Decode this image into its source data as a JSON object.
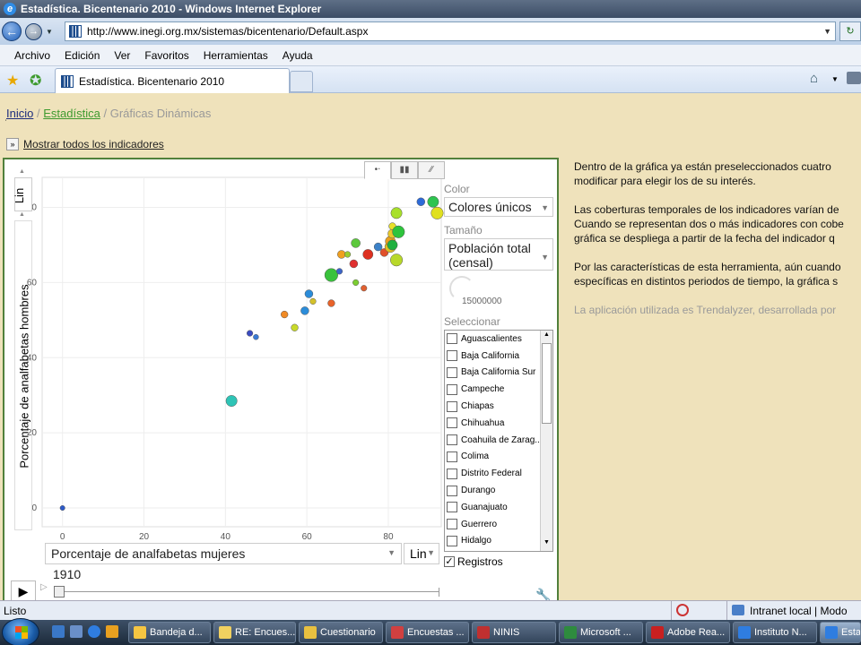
{
  "window": {
    "title": "Estadística. Bicentenario 2010 - Windows Internet Explorer"
  },
  "address": {
    "url": "http://www.inegi.org.mx/sistemas/bicentenario/Default.aspx"
  },
  "menu": [
    "Archivo",
    "Edición",
    "Ver",
    "Favoritos",
    "Herramientas",
    "Ayuda"
  ],
  "tab": {
    "title": "Estadística. Bicentenario 2010"
  },
  "breadcrumb": {
    "home": "Inicio",
    "section": "Estadística",
    "current": "Gráficas Dinámicas",
    "sep": "/"
  },
  "show_all": "Mostrar todos los indicadores",
  "chart_controls": {
    "y_scale": "Lin",
    "y_label": "Porcentaje de analfabetas hombres",
    "x_label": "Porcentaje de analfabetas mujeres",
    "x_scale": "Lin",
    "color_head": "Color",
    "color_value": "Colores únicos",
    "size_head": "Tamaño",
    "size_value": "Población total (censal)",
    "size_legend": "15000000",
    "select_head": "Seleccionar",
    "registros": "Registros",
    "year": "1910",
    "states": [
      "Aguascalientes",
      "Baja California",
      "Baja California Sur",
      "Campeche",
      "Chiapas",
      "Chihuahua",
      "Coahuila de Zarag...",
      "Colima",
      "Distrito Federal",
      "Durango",
      "Guanajuato",
      "Guerrero",
      "Hidalgo"
    ]
  },
  "chart_data": {
    "type": "scatter",
    "xlabel": "Porcentaje de analfabetas mujeres",
    "ylabel": "Porcentaje de analfabetas hombres",
    "xlim": [
      -5,
      93
    ],
    "ylim": [
      -5,
      88
    ],
    "xticks": [
      "0",
      "20",
      "40",
      "60",
      "80"
    ],
    "yticks": [
      "0",
      "20",
      "40",
      "60",
      "80"
    ],
    "points": [
      {
        "x": 0,
        "y": 0,
        "s": 1,
        "c": "#2d5ac8"
      },
      {
        "x": 41.5,
        "y": 28.5,
        "s": 4,
        "c": "#2ec4b6"
      },
      {
        "x": 46,
        "y": 46.5,
        "s": 1.5,
        "c": "#3b4cc0"
      },
      {
        "x": 47.5,
        "y": 45.5,
        "s": 1.2,
        "c": "#3a7bd5"
      },
      {
        "x": 54.5,
        "y": 51.5,
        "s": 2,
        "c": "#f08a24"
      },
      {
        "x": 57,
        "y": 48,
        "s": 2,
        "c": "#c8d92a"
      },
      {
        "x": 59.5,
        "y": 52.5,
        "s": 2.5,
        "c": "#2b8cd9"
      },
      {
        "x": 60.5,
        "y": 57,
        "s": 2.5,
        "c": "#2b8cd9"
      },
      {
        "x": 61.5,
        "y": 55,
        "s": 1.5,
        "c": "#d4c12a"
      },
      {
        "x": 66,
        "y": 54.5,
        "s": 2,
        "c": "#e8632a"
      },
      {
        "x": 66,
        "y": 62,
        "s": 5,
        "c": "#39c23c"
      },
      {
        "x": 68,
        "y": 63,
        "s": 1.5,
        "c": "#3c64c8"
      },
      {
        "x": 68.5,
        "y": 67.5,
        "s": 2.5,
        "c": "#f0a020"
      },
      {
        "x": 70,
        "y": 67.5,
        "s": 1.5,
        "c": "#9acd32"
      },
      {
        "x": 71.5,
        "y": 65,
        "s": 2.5,
        "c": "#e03030"
      },
      {
        "x": 72,
        "y": 60,
        "s": 1.5,
        "c": "#7ccd32"
      },
      {
        "x": 74,
        "y": 58.5,
        "s": 1.5,
        "c": "#e06030"
      },
      {
        "x": 72,
        "y": 70.5,
        "s": 3,
        "c": "#5cc83c"
      },
      {
        "x": 75,
        "y": 67.5,
        "s": 3.5,
        "c": "#dd3020"
      },
      {
        "x": 77.5,
        "y": 69.5,
        "s": 2.5,
        "c": "#3c82c8"
      },
      {
        "x": 79,
        "y": 68,
        "s": 2.5,
        "c": "#e0502a"
      },
      {
        "x": 80.5,
        "y": 69.5,
        "s": 4,
        "c": "#e0c020"
      },
      {
        "x": 80.5,
        "y": 71,
        "s": 3.5,
        "c": "#e8a020"
      },
      {
        "x": 81,
        "y": 73,
        "s": 3,
        "c": "#e8c82a"
      },
      {
        "x": 81,
        "y": 75,
        "s": 2,
        "c": "#e8e02a"
      },
      {
        "x": 81,
        "y": 70,
        "s": 3.5,
        "c": "#20b040"
      },
      {
        "x": 82.5,
        "y": 73.5,
        "s": 4.5,
        "c": "#2ec43c"
      },
      {
        "x": 82,
        "y": 66,
        "s": 4.5,
        "c": "#b8d82a"
      },
      {
        "x": 82,
        "y": 78.5,
        "s": 4,
        "c": "#a8e02a"
      },
      {
        "x": 88,
        "y": 81.5,
        "s": 2.5,
        "c": "#2d6ad8"
      },
      {
        "x": 91,
        "y": 81.5,
        "s": 4,
        "c": "#2ec450"
      },
      {
        "x": 92,
        "y": 78.5,
        "s": 4.5,
        "c": "#e0e020"
      }
    ]
  },
  "description": {
    "p1a": "Dentro de la gráfica ya están preseleccionados cuatro",
    "p1b": "modificar para elegir los de su interés.",
    "p2a": "Las coberturas temporales de los indicadores varían de",
    "p2b": "Cuando se representan dos o más indicadores con cobe",
    "p2c": "gráfica se despliega a partir de la fecha del indicador q",
    "p3a": "Por las características de esta herramienta, aún cuando",
    "p3b": "específicas en distintos periodos de tiempo, la gráfica s",
    "p4": "La aplicación utilizada es Trendalyzer, desarrollada por"
  },
  "status": {
    "left": "Listo",
    "zone": "Intranet local | Modo proteg"
  },
  "taskbar": [
    {
      "label": "Bandeja d...",
      "color": "#f5c542"
    },
    {
      "label": "RE: Encues...",
      "color": "#f0d060"
    },
    {
      "label": "Cuestionario",
      "color": "#e8c040"
    },
    {
      "label": "Encuestas ...",
      "color": "#d04040"
    },
    {
      "label": "NINIS",
      "color": "#c03030"
    },
    {
      "label": "Microsoft ...",
      "color": "#2e8b3e"
    },
    {
      "label": "Adobe Rea...",
      "color": "#c82020"
    },
    {
      "label": "Instituto N...",
      "color": "#2f7de0"
    },
    {
      "label": "Esta",
      "color": "#2f7de0"
    }
  ]
}
